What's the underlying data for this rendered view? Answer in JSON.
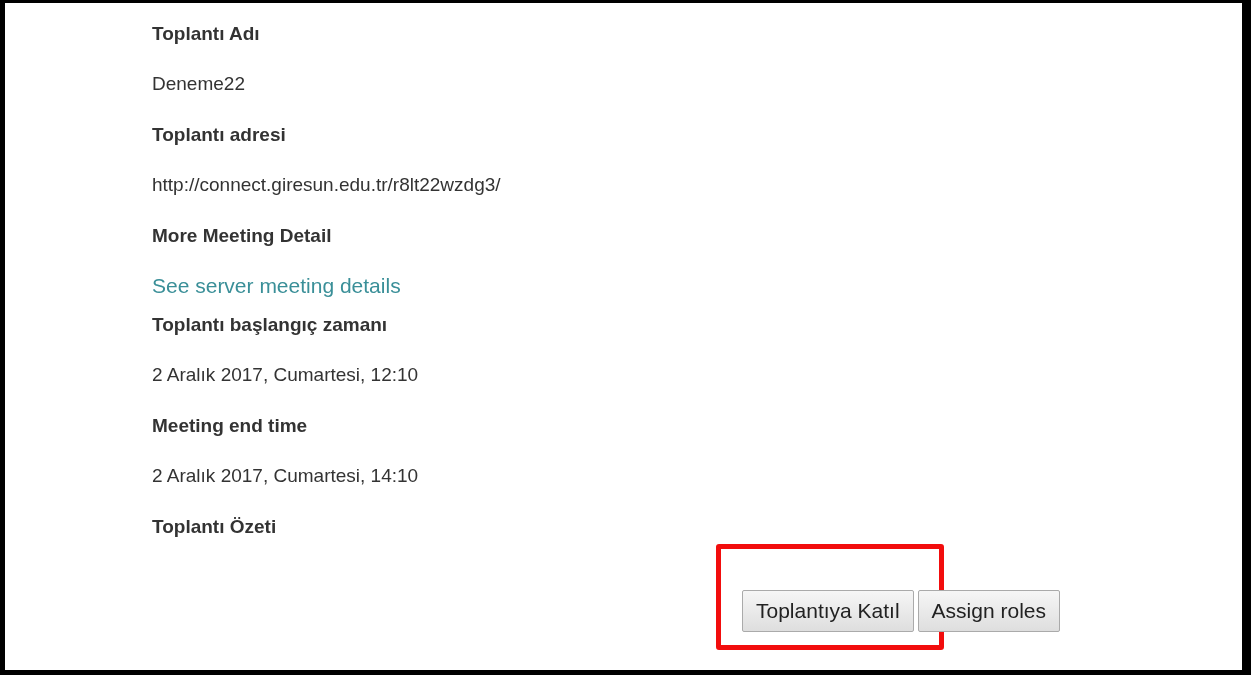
{
  "items": [
    {
      "kind": "heading",
      "text": "Toplantı Adı"
    },
    {
      "kind": "text",
      "text": "Deneme22"
    },
    {
      "kind": "heading",
      "text": "Toplantı adresi"
    },
    {
      "kind": "text",
      "text": "http://connect.giresun.edu.tr/r8lt22wzdg3/"
    },
    {
      "kind": "heading",
      "text": "More Meeting Detail"
    },
    {
      "kind": "link",
      "text": "See server meeting details"
    },
    {
      "kind": "heading",
      "text": "Toplantı başlangıç zamanı"
    },
    {
      "kind": "text",
      "text": "2 Aralık 2017, Cumartesi, 12:10"
    },
    {
      "kind": "heading",
      "text": "Meeting end time"
    },
    {
      "kind": "text",
      "text": "2 Aralık 2017, Cumartesi, 14:10"
    },
    {
      "kind": "heading",
      "text": "Toplantı Özeti"
    }
  ],
  "buttons": [
    {
      "label": "Toplantıya Katıl",
      "highlighted": true
    },
    {
      "label": "Assign roles",
      "highlighted": false
    }
  ]
}
